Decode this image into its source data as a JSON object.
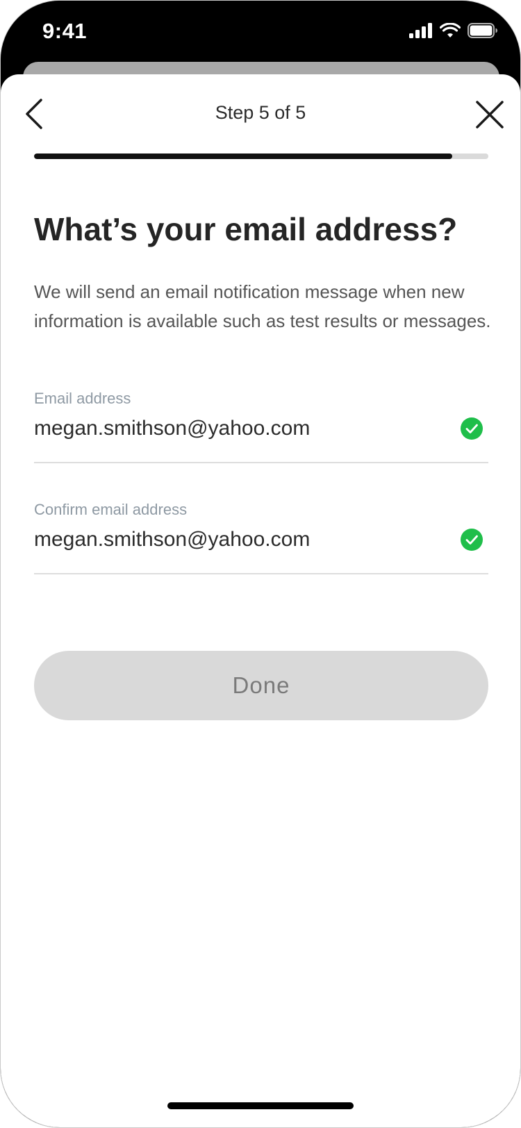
{
  "status_bar": {
    "time": "9:41",
    "icons": [
      "cellular-signal-icon",
      "wifi-icon",
      "battery-icon"
    ]
  },
  "nav": {
    "title": "Step 5 of 5",
    "back_icon": "chevron-left-icon",
    "close_icon": "close-icon"
  },
  "progress": {
    "current_step": 5,
    "total_steps": 5,
    "fill_fraction": 0.92
  },
  "page": {
    "heading": "What’s your email address?",
    "description": "We will send an email notification message when new information is available such as test results or messages."
  },
  "form": {
    "email": {
      "label": "Email address",
      "value": "megan.smithson@yahoo.com",
      "status_icon": "check-circle-icon"
    },
    "confirm_email": {
      "label": "Confirm email address",
      "value": "megan.smithson@yahoo.com",
      "status_icon": "check-circle-icon"
    },
    "submit_label": "Done"
  },
  "colors": {
    "success": "#1fbe4a",
    "progress_fill": "#111111",
    "progress_track": "#dadada",
    "button_disabled_bg": "#d9d9d9",
    "button_disabled_text": "#7a7a7a"
  }
}
